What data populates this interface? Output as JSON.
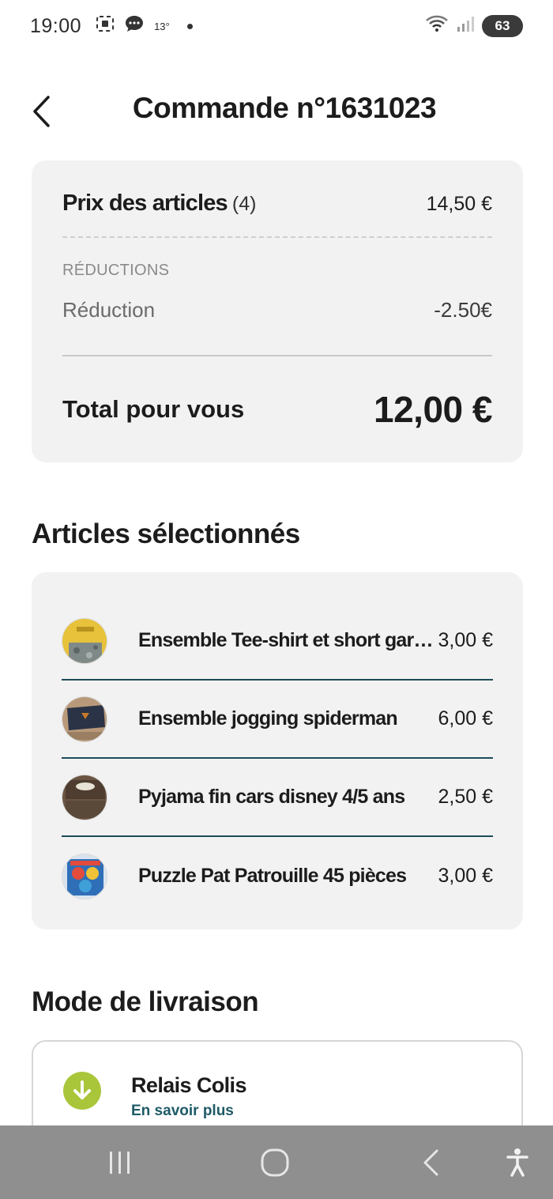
{
  "status_bar": {
    "time": "19:00",
    "temperature": "13°",
    "battery": "63",
    "icons": [
      "screenshot-icon",
      "chat-bubble-icon",
      "wifi-icon",
      "signal-icon",
      "battery-icon"
    ]
  },
  "header": {
    "title": "Commande n°1631023",
    "back_icon": "chevron-left-icon"
  },
  "summary": {
    "items_label": "Prix des articles",
    "items_count": "(4)",
    "items_value": "14,50 €",
    "reductions_heading": "RÉDUCTIONS",
    "reduction_label": "Réduction",
    "reduction_value": "-2.50€",
    "total_label": "Total pour vous",
    "total_value": "12,00 €"
  },
  "articles": {
    "title": "Articles sélectionnés",
    "items": [
      {
        "name": "Ensemble Tee-shirt et short garçon",
        "price": "3,00 €"
      },
      {
        "name": "Ensemble jogging spiderman",
        "price": "6,00 €"
      },
      {
        "name": "Pyjama fin cars disney 4/5 ans",
        "price": "2,50 €"
      },
      {
        "name": "Puzzle Pat Patrouille 45 pièces",
        "price": "3,00 €"
      }
    ]
  },
  "delivery": {
    "title": "Mode de livraison",
    "option_name": "Relais Colis",
    "more_link": "En savoir plus",
    "icon": "arrow-down-circle-icon",
    "icon_color": "#a9c63a"
  },
  "nav_bar": {
    "buttons": [
      "recent-apps-icon",
      "home-icon",
      "back-icon",
      "accessibility-icon"
    ]
  },
  "colors": {
    "card_bg": "#f2f2f2",
    "separator_teal": "#1e4c57",
    "link_teal": "#1e5a66",
    "nav_bg": "#8f8f8f"
  }
}
